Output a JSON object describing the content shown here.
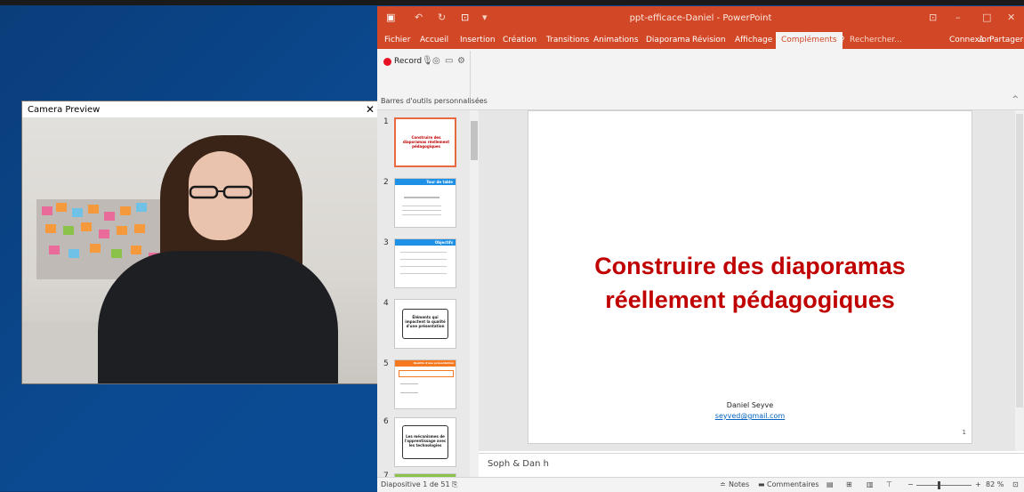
{
  "camera": {
    "title": "Camera Preview",
    "close": "✕"
  },
  "ppt": {
    "title": "ppt-efficace-Daniel - PowerPoint",
    "menu": [
      "Fichier",
      "Accueil",
      "Insertion",
      "Création",
      "Transitions",
      "Animations",
      "Diaporama",
      "Révision",
      "Affichage"
    ],
    "active_tab": "Compléments",
    "search": "Rechercher...",
    "connexion": "Connexion",
    "partager": "Partager",
    "ribbon": {
      "record": "Record",
      "group_label": "Barres d'outils personnalisées"
    },
    "thumbnails": [
      {
        "num": "1",
        "text": "Construire des diaporamas réellement pédagogiques"
      },
      {
        "num": "2",
        "text": "Tour de table"
      },
      {
        "num": "3",
        "text": "Objectifs"
      },
      {
        "num": "4",
        "text": "Éléments qui impactent la qualité d'une présentation"
      },
      {
        "num": "5",
        "text": "Qualité d'une présentation"
      },
      {
        "num": "6",
        "text": "Les mécanismes de l'apprentissage avec les technologies"
      },
      {
        "num": "7",
        "text": ""
      }
    ],
    "slide": {
      "title_line1": "Construire des diaporamas",
      "title_line2": "réellement pédagogiques",
      "author": "Daniel Seyve",
      "email": "seyved@gmail.com",
      "number": "1"
    },
    "notes": "Soph & Dan h",
    "status": {
      "slide": "Diapositive 1 de 51",
      "notes": "Notes",
      "comments": "Commentaires",
      "zoom": "82 %"
    },
    "accent": "#d24726"
  }
}
